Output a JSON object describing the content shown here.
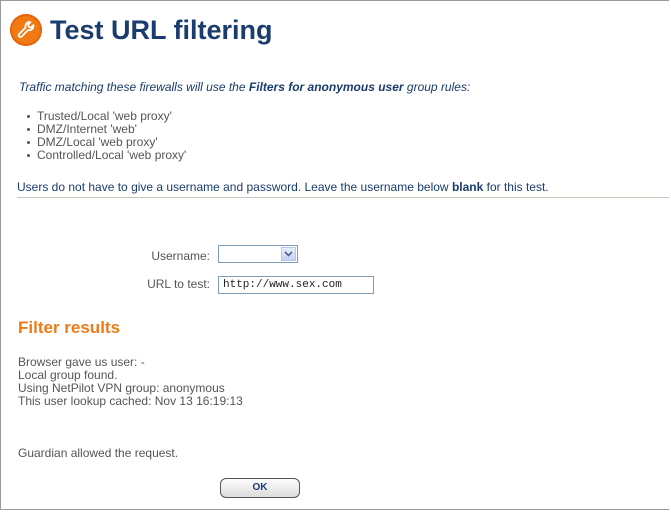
{
  "page": {
    "title": "Test URL filtering",
    "title_icon": "wrench-icon"
  },
  "intro": {
    "text_before": "Traffic matching these firewalls will use the ",
    "group_name": "Filters for anonymous user",
    "text_after": " group rules:"
  },
  "firewalls": [
    "Trusted/Local 'web proxy'",
    "DMZ/Internet 'web'",
    "DMZ/Local 'web proxy'",
    "Controlled/Local 'web proxy'"
  ],
  "notice": {
    "text_before": "Users do not have to give a username and password. Leave the username below ",
    "emphasis": "blank",
    "text_after": " for this test."
  },
  "form": {
    "username_label": "Username:",
    "username_value": "",
    "url_label": "URL to test:",
    "url_value": "http://www.sex.com"
  },
  "results": {
    "heading": "Filter results",
    "lines": [
      "Browser gave us user: -",
      "Local group found.",
      "Using NetPilot VPN group: anonymous",
      "This user lookup cached: Nov 13 16:19:13"
    ],
    "verdict": "Guardian allowed the request."
  },
  "buttons": {
    "ok_label": "OK"
  },
  "colors": {
    "title": "#1a3c6e",
    "accent_orange": "#ee7a16",
    "body_text": "#555555",
    "divider": "#c8c8b8"
  }
}
